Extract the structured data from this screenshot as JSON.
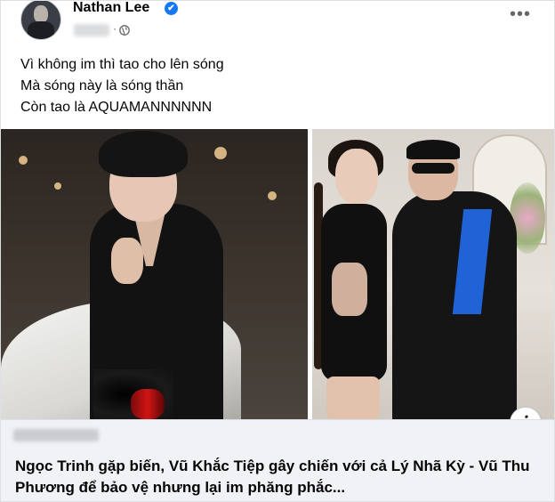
{
  "post": {
    "author_name": "Nathan Lee",
    "verified_badge": "✔",
    "meta_separator": "·",
    "more_button_label": "•••",
    "caption_lines": [
      "Vì không im thì tao cho lên sóng",
      "Mà sóng này là sóng thần",
      "Còn tao là AQUAMANNNNNN"
    ]
  },
  "link_preview": {
    "title": "Ngọc Trinh gặp biến, Vũ Khắc Tiệp gây chiến với cả Lý Nhã Kỳ - Vũ Thu Phương để bảo vệ nhưng lại im phăng phắc...",
    "info_icon_label": "i"
  },
  "icons": {
    "avatar": "profile-photo",
    "verified": "verified-badge-icon",
    "privacy": "globe-icon",
    "more": "more-options-icon",
    "info": "info-icon"
  },
  "colors": {
    "verified_blue": "#1877f2",
    "text_primary": "#050505",
    "text_secondary": "#65676b",
    "link_preview_bg": "#f0f2f5"
  }
}
